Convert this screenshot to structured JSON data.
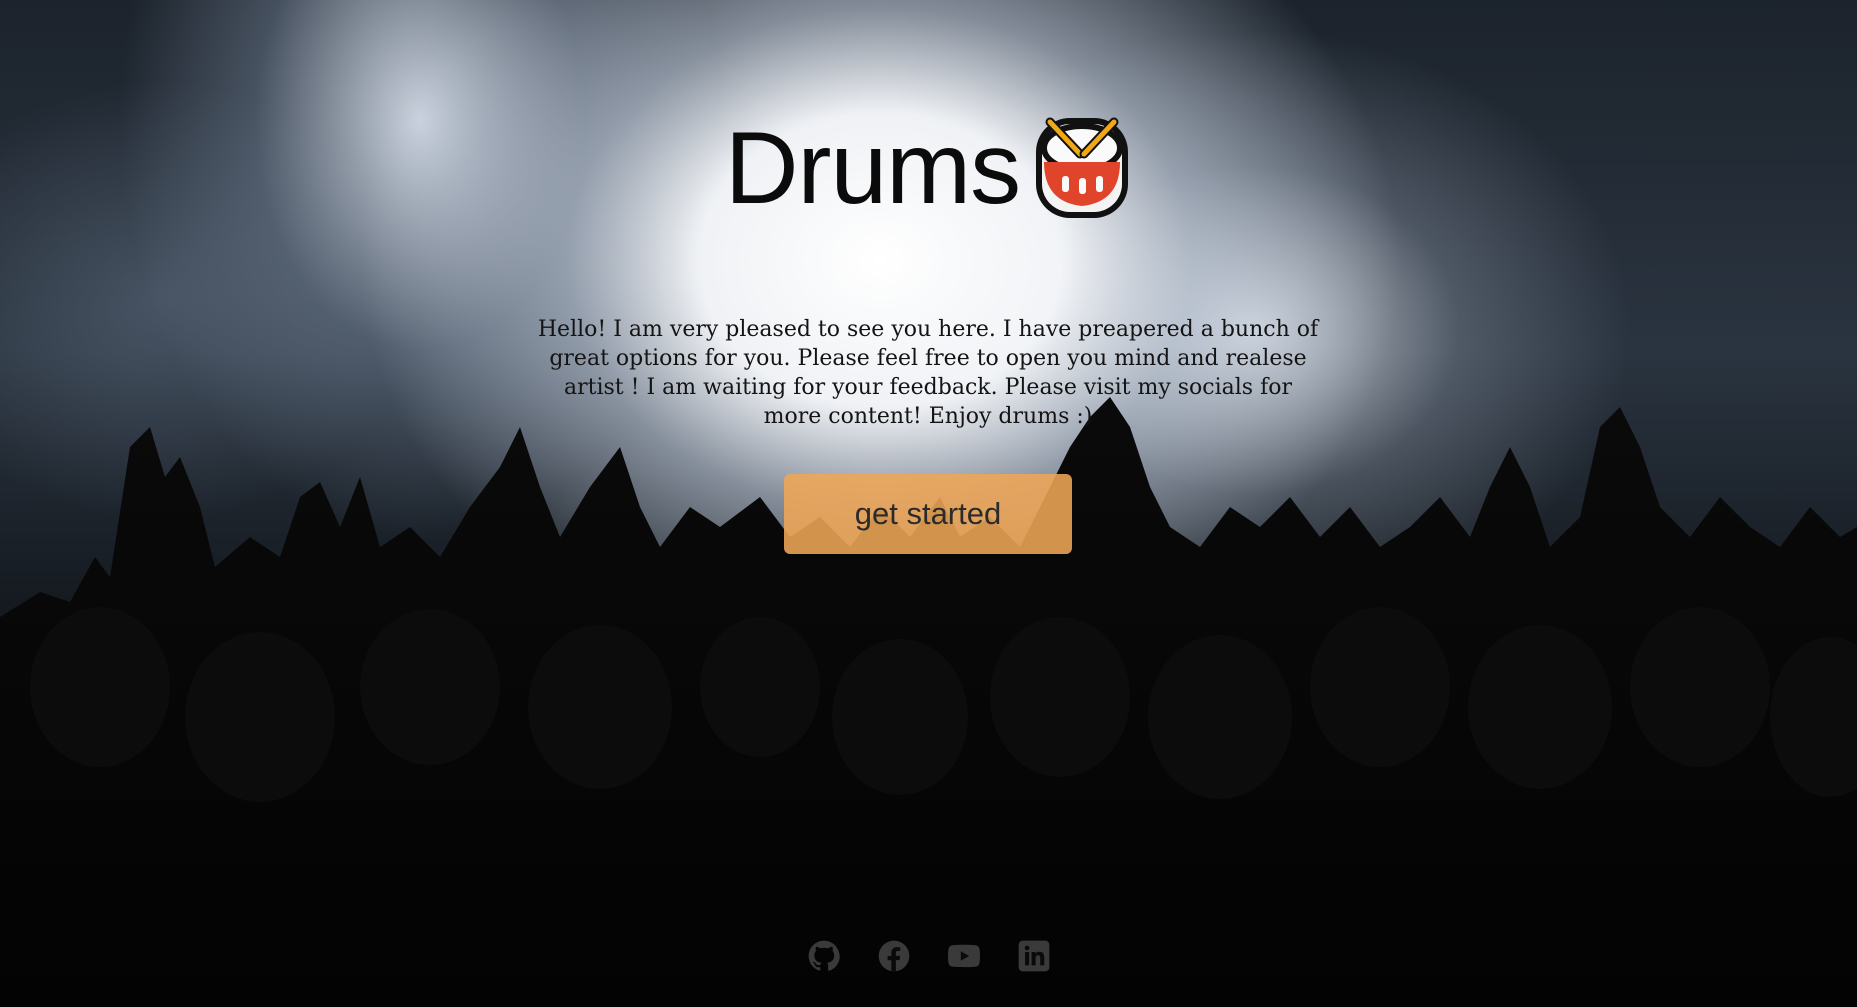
{
  "hero": {
    "title": "Drums",
    "title_icon": "drum-emoji-icon",
    "intro": "Hello! I am very pleased to see you here. I have preapered a bunch of great options for you. Please feel free to open you mind and realese artist ! I am waiting for your feedback. Please visit my socials for more content! Enjoy drums :)",
    "cta_label": "get started"
  },
  "socials": [
    {
      "name": "github",
      "icon": "github-icon"
    },
    {
      "name": "facebook",
      "icon": "facebook-icon"
    },
    {
      "name": "youtube",
      "icon": "youtube-icon"
    },
    {
      "name": "linkedin",
      "icon": "linkedin-icon"
    }
  ],
  "colors": {
    "cta_background": "#eea656",
    "title_text": "#0b0b0b",
    "social_icon": "#3a3a3a"
  }
}
